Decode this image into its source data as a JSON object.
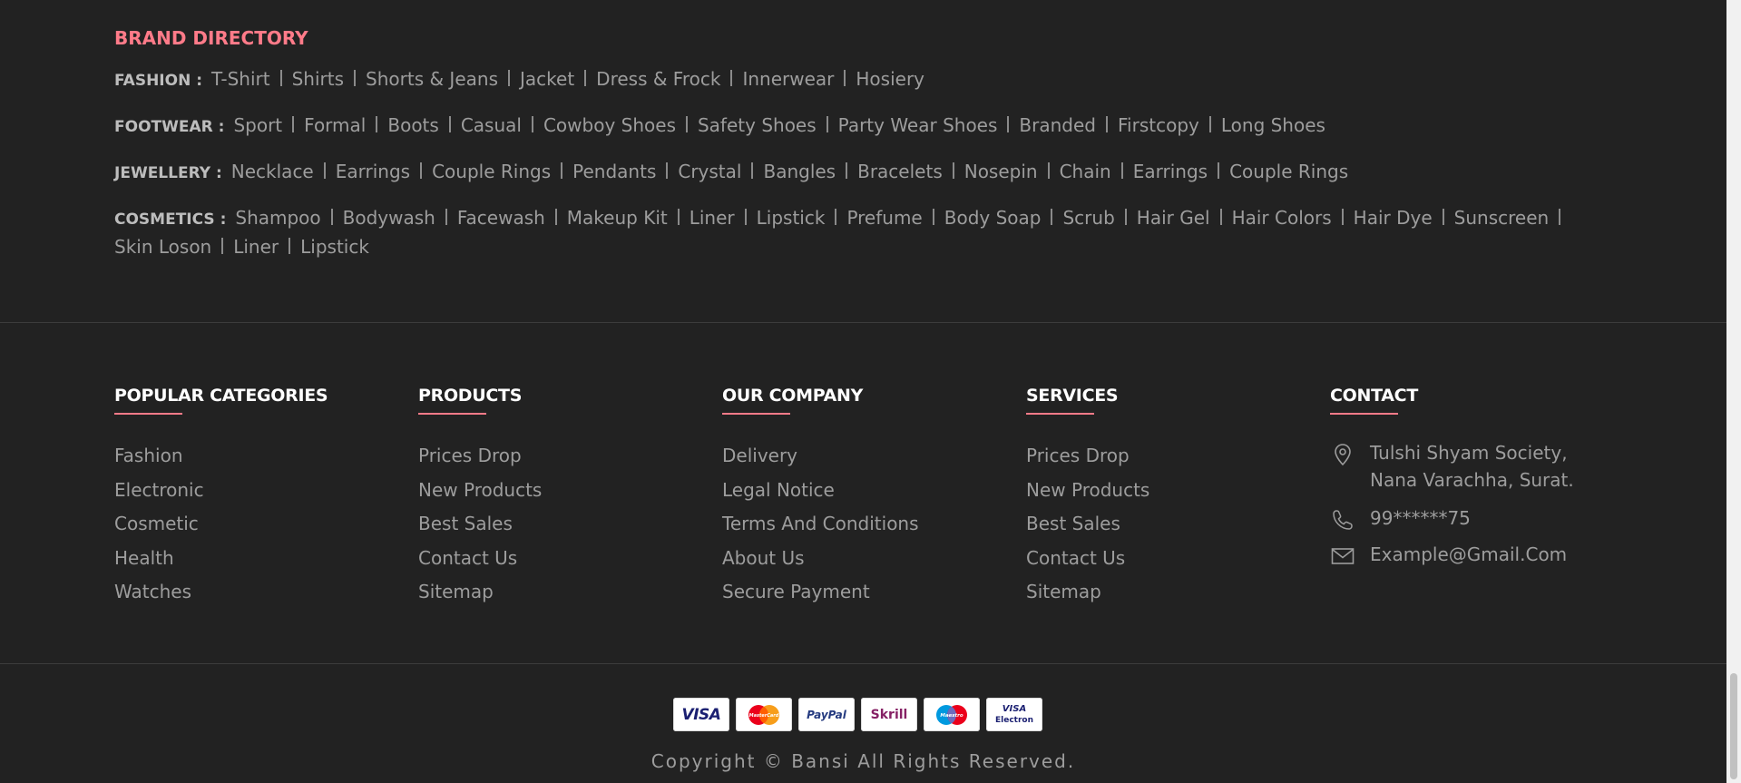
{
  "brand_directory": {
    "title": "BRAND DIRECTORY",
    "rows": [
      {
        "label": "FASHION :",
        "items": [
          "T-Shirt",
          "Shirts",
          "Shorts & Jeans",
          "Jacket",
          "Dress & Frock",
          "Innerwear",
          "Hosiery"
        ]
      },
      {
        "label": "FOOTWEAR :",
        "items": [
          "Sport",
          "Formal",
          "Boots",
          "Casual",
          "Cowboy Shoes",
          "Safety Shoes",
          "Party Wear Shoes",
          "Branded",
          "Firstcopy",
          "Long Shoes"
        ]
      },
      {
        "label": "JEWELLERY :",
        "items": [
          "Necklace",
          "Earrings",
          "Couple Rings",
          "Pendants",
          "Crystal",
          "Bangles",
          "Bracelets",
          "Nosepin",
          "Chain",
          "Earrings",
          "Couple Rings"
        ]
      },
      {
        "label": "COSMETICS :",
        "items": [
          "Shampoo",
          "Bodywash",
          "Facewash",
          "Makeup Kit",
          "Liner",
          "Lipstick",
          "Prefume",
          "Body Soap",
          "Scrub",
          "Hair Gel",
          "Hair Colors",
          "Hair Dye",
          "Sunscreen",
          "Skin Loson",
          "Liner",
          "Lipstick"
        ]
      }
    ]
  },
  "footer_columns": {
    "popular": {
      "title": "POPULAR CATEGORIES",
      "items": [
        "Fashion",
        "Electronic",
        "Cosmetic",
        "Health",
        "Watches"
      ]
    },
    "products": {
      "title": "PRODUCTS",
      "items": [
        "Prices Drop",
        "New Products",
        "Best Sales",
        "Contact Us",
        "Sitemap"
      ]
    },
    "company": {
      "title": "OUR COMPANY",
      "items": [
        "Delivery",
        "Legal Notice",
        "Terms And Conditions",
        "About Us",
        "Secure Payment"
      ]
    },
    "services": {
      "title": "SERVICES",
      "items": [
        "Prices Drop",
        "New Products",
        "Best Sales",
        "Contact Us",
        "Sitemap"
      ]
    },
    "contact": {
      "title": "CONTACT",
      "address_line1": "Tulshi Shyam Society,",
      "address_line2": "Nana Varachha, Surat.",
      "phone": "99******75",
      "email": "Example@Gmail.Com"
    }
  },
  "payments": {
    "cards": [
      {
        "name": "visa",
        "label": "VISA"
      },
      {
        "name": "mastercard",
        "label": "MasterCard"
      },
      {
        "name": "paypal",
        "label": "PayPal"
      },
      {
        "name": "skrill",
        "label": "Skrill"
      },
      {
        "name": "maestro",
        "label": "Maestro"
      },
      {
        "name": "visa-electron",
        "label_top": "VISA",
        "label_bottom": "Electron"
      }
    ]
  },
  "copyright": "Copyright © Bansi All Rights Reserved.",
  "colors": {
    "accent": "#ff7b89",
    "background": "#222222",
    "muted_text": "#9d9d9d"
  }
}
